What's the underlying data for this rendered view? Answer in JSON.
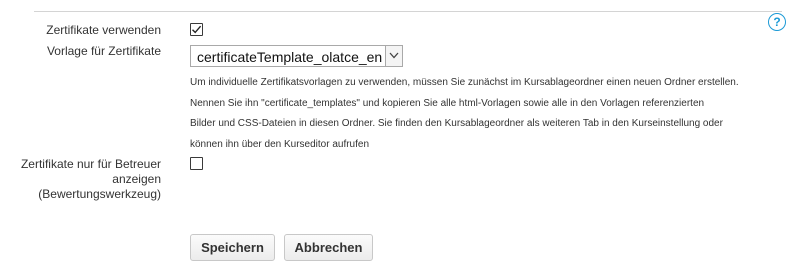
{
  "help": {
    "icon": "question-circle-icon",
    "glyph": "?"
  },
  "form": {
    "use_certificates": {
      "label": "Zertifikate verwenden",
      "checked": true
    },
    "template": {
      "label": "Vorlage für Zertifikate",
      "selected_value": "certificateTemplate_olatce_en",
      "help_lines": [
        "Um individuelle Zertifikatsvorlagen zu verwenden, müssen Sie zunächst im Kursablageordner einen neuen Ordner erstellen.",
        "Nennen Sie ihn \"certificate_templates\" und kopieren Sie alle html-Vorlagen sowie alle in den Vorlagen referenzierten",
        "Bilder und CSS-Dateien in diesen Ordner. Sie finden den Kursablageordner als weiteren Tab in den Kurseinstellung oder",
        "können ihn über den Kurseditor aufrufen"
      ]
    },
    "coach_only": {
      "label_lines": [
        "Zertifikate nur für Betreuer",
        "anzeigen",
        "(Bewertungswerkzeug)"
      ],
      "checked": false
    }
  },
  "buttons": {
    "save": "Speichern",
    "cancel": "Abbrechen"
  },
  "colors": {
    "accent": "#1c9ad6",
    "text": "#333333"
  }
}
